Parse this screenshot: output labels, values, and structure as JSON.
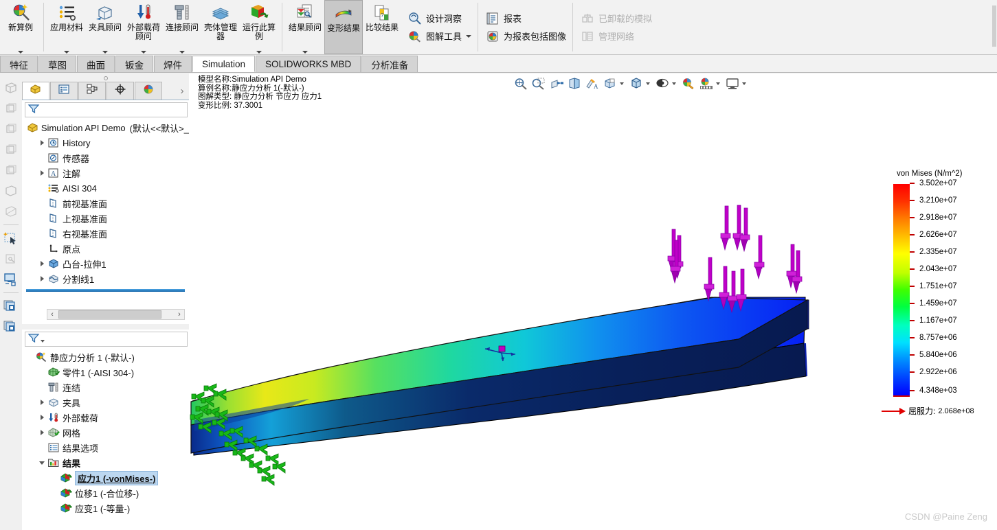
{
  "ribbon": {
    "groups": [
      {
        "buttons": [
          {
            "label": "新算例",
            "icon": "new-study-icon",
            "dropdown": false
          }
        ]
      },
      {
        "buttons": [
          {
            "label": "应用材料",
            "icon": "apply-material-icon",
            "dropdown": true
          },
          {
            "label": "夹具顾问",
            "icon": "fixture-advisor-icon",
            "dropdown": true
          },
          {
            "label": "外部载荷顾问",
            "icon": "external-loads-advisor-icon",
            "dropdown": true
          },
          {
            "label": "连接顾问",
            "icon": "connections-advisor-icon",
            "dropdown": true
          },
          {
            "label": "壳体管理器",
            "icon": "shell-manager-icon",
            "dropdown": false
          },
          {
            "label": "运行此算例",
            "icon": "run-this-study-icon",
            "dropdown": true
          }
        ]
      },
      {
        "buttons": [
          {
            "label": "结果顾问",
            "icon": "results-advisor-icon",
            "dropdown": true
          },
          {
            "label": "变形结果",
            "icon": "deformed-result-icon",
            "dropdown": false,
            "selected": true
          },
          {
            "label": "比较结果",
            "icon": "compare-results-icon",
            "dropdown": false
          }
        ]
      }
    ],
    "small_groups": [
      {
        "items": [
          {
            "label": "设计洞察",
            "icon": "design-insight-icon",
            "disabled": false,
            "dropdown": false
          },
          {
            "label": "图解工具",
            "icon": "plot-tools-icon",
            "disabled": false,
            "dropdown": true
          }
        ]
      },
      {
        "items": [
          {
            "label": "报表",
            "icon": "report-icon",
            "disabled": false,
            "dropdown": false
          },
          {
            "label": "为报表包括图像",
            "icon": "include-image-for-report-icon",
            "disabled": false,
            "dropdown": false
          }
        ]
      },
      {
        "items": [
          {
            "label": "已卸载的模拟",
            "icon": "offloaded-simulation-icon",
            "disabled": true,
            "dropdown": false
          },
          {
            "label": "管理网络",
            "icon": "manage-network-icon",
            "disabled": true,
            "dropdown": false
          }
        ]
      }
    ]
  },
  "tabs": [
    {
      "label": "特征",
      "active": false
    },
    {
      "label": "草图",
      "active": false
    },
    {
      "label": "曲面",
      "active": false
    },
    {
      "label": "钣金",
      "active": false
    },
    {
      "label": "焊件",
      "active": false
    },
    {
      "label": "Simulation",
      "active": true
    },
    {
      "label": "SOLIDWORKS MBD",
      "active": false
    },
    {
      "label": "分析准备",
      "active": false
    }
  ],
  "feature_panel": {
    "tabs": [
      {
        "icon": "feature-manager-icon",
        "active": true
      },
      {
        "icon": "property-manager-icon",
        "active": false
      },
      {
        "icon": "configuration-manager-icon",
        "active": false
      },
      {
        "icon": "dimxpert-manager-icon",
        "active": false
      },
      {
        "icon": "display-manager-icon",
        "active": false
      }
    ],
    "more_label": "›",
    "filter_icon": "filter-icon",
    "tree": [
      {
        "label": "Simulation API Demo",
        "suffix": "(默认<<默认>_",
        "icon": "part-icon",
        "indent": 0,
        "arrow": "none"
      },
      {
        "label": "History",
        "icon": "history-icon",
        "indent": 1,
        "arrow": "right"
      },
      {
        "label": "传感器",
        "icon": "sensors-icon",
        "indent": 1,
        "arrow": "none"
      },
      {
        "label": "注解",
        "icon": "annotations-icon",
        "indent": 1,
        "arrow": "right"
      },
      {
        "label": "AISI 304",
        "icon": "material-icon",
        "indent": 1,
        "arrow": "none"
      },
      {
        "label": "前视基准面",
        "icon": "plane-icon",
        "indent": 1,
        "arrow": "none"
      },
      {
        "label": "上视基准面",
        "icon": "plane-icon",
        "indent": 1,
        "arrow": "none"
      },
      {
        "label": "右视基准面",
        "icon": "plane-icon",
        "indent": 1,
        "arrow": "none"
      },
      {
        "label": "原点",
        "icon": "origin-icon",
        "indent": 1,
        "arrow": "none"
      },
      {
        "label": "凸台-拉伸1",
        "icon": "boss-extrude-icon",
        "indent": 1,
        "arrow": "right"
      },
      {
        "label": "分割线1",
        "icon": "split-line-icon",
        "indent": 1,
        "arrow": "right"
      }
    ]
  },
  "simulation_panel": {
    "filter_icon": "filter-icon",
    "tree": [
      {
        "label": "静应力分析 1 (-默认-)",
        "icon": "study-icon",
        "indent": 0,
        "arrow": "none"
      },
      {
        "label": "零件1 (-AISI 304-)",
        "icon": "solid-body-icon",
        "indent": 1,
        "arrow": "none"
      },
      {
        "label": "连结",
        "icon": "connections-icon",
        "indent": 1,
        "arrow": "none"
      },
      {
        "label": "夹具",
        "icon": "fixtures-icon",
        "indent": 1,
        "arrow": "right"
      },
      {
        "label": "外部载荷",
        "icon": "external-loads-icon",
        "indent": 1,
        "arrow": "right"
      },
      {
        "label": "网格",
        "icon": "mesh-icon",
        "indent": 1,
        "arrow": "right"
      },
      {
        "label": "结果选项",
        "icon": "result-options-icon",
        "indent": 1,
        "arrow": "none"
      },
      {
        "label": "结果",
        "icon": "results-folder-icon",
        "indent": 1,
        "arrow": "down",
        "bold": true
      },
      {
        "label": "应力1 (-vonMises-)",
        "icon": "stress-plot-icon",
        "indent": 2,
        "arrow": "none",
        "selected": true
      },
      {
        "label": "位移1 (-合位移-)",
        "icon": "displacement-plot-icon",
        "indent": 2,
        "arrow": "none"
      },
      {
        "label": "应变1 (-等量-)",
        "icon": "strain-plot-icon",
        "indent": 2,
        "arrow": "none"
      }
    ]
  },
  "viewport": {
    "toolbar_icons": [
      {
        "icon": "zoom-to-fit-icon",
        "dropdown": false
      },
      {
        "icon": "zoom-to-area-icon",
        "dropdown": false
      },
      {
        "icon": "section-view-icon",
        "dropdown": false
      },
      {
        "icon": "iso-clipping-icon",
        "dropdown": false
      },
      {
        "icon": "probe-icon",
        "dropdown": false
      },
      {
        "icon": "view-orientation-icon",
        "dropdown": true
      },
      {
        "icon": "display-style-icon",
        "dropdown": true
      },
      {
        "icon": "hide-show-items-icon",
        "dropdown": true
      },
      {
        "icon": "edit-appearance-icon",
        "dropdown": false
      },
      {
        "icon": "apply-scene-icon",
        "dropdown": true
      },
      {
        "icon": "view-settings-icon",
        "dropdown": true
      }
    ],
    "annotation": {
      "model_name": "模型名称:Simulation API Demo",
      "study_name": "算例名称:静应力分析 1(-默认-)",
      "plot_type": "图解类型: 静应力分析 节应力 应力1",
      "deform_scale": "变形比例: 37.3001"
    }
  },
  "chart_data": {
    "type": "heatmap",
    "title": "von Mises (N/m^2)",
    "legend_position": "right",
    "unit": "N/m^2",
    "quantity": "von Mises",
    "ticks": [
      "3.502e+07",
      "3.210e+07",
      "2.918e+07",
      "2.626e+07",
      "2.335e+07",
      "2.043e+07",
      "1.751e+07",
      "1.459e+07",
      "1.167e+07",
      "8.757e+06",
      "5.840e+06",
      "2.922e+06",
      "4.348e+03"
    ],
    "values": [
      35020000,
      32100000,
      29180000,
      26260000,
      23350000,
      20430000,
      17510000,
      14590000,
      11670000,
      8757000,
      5840000,
      2922000,
      4348
    ],
    "range_min": 4348,
    "range_max": 35020000,
    "colormap": [
      "#0000ff",
      "#00ffff",
      "#00ff00",
      "#ffff00",
      "#ff0000"
    ],
    "yield_label": "屈服力:",
    "yield_value": "2.068e+08",
    "yield_numeric": 206800000,
    "yield_marker_color": "#e00000"
  },
  "watermark": "CSDN @Paine Zeng"
}
